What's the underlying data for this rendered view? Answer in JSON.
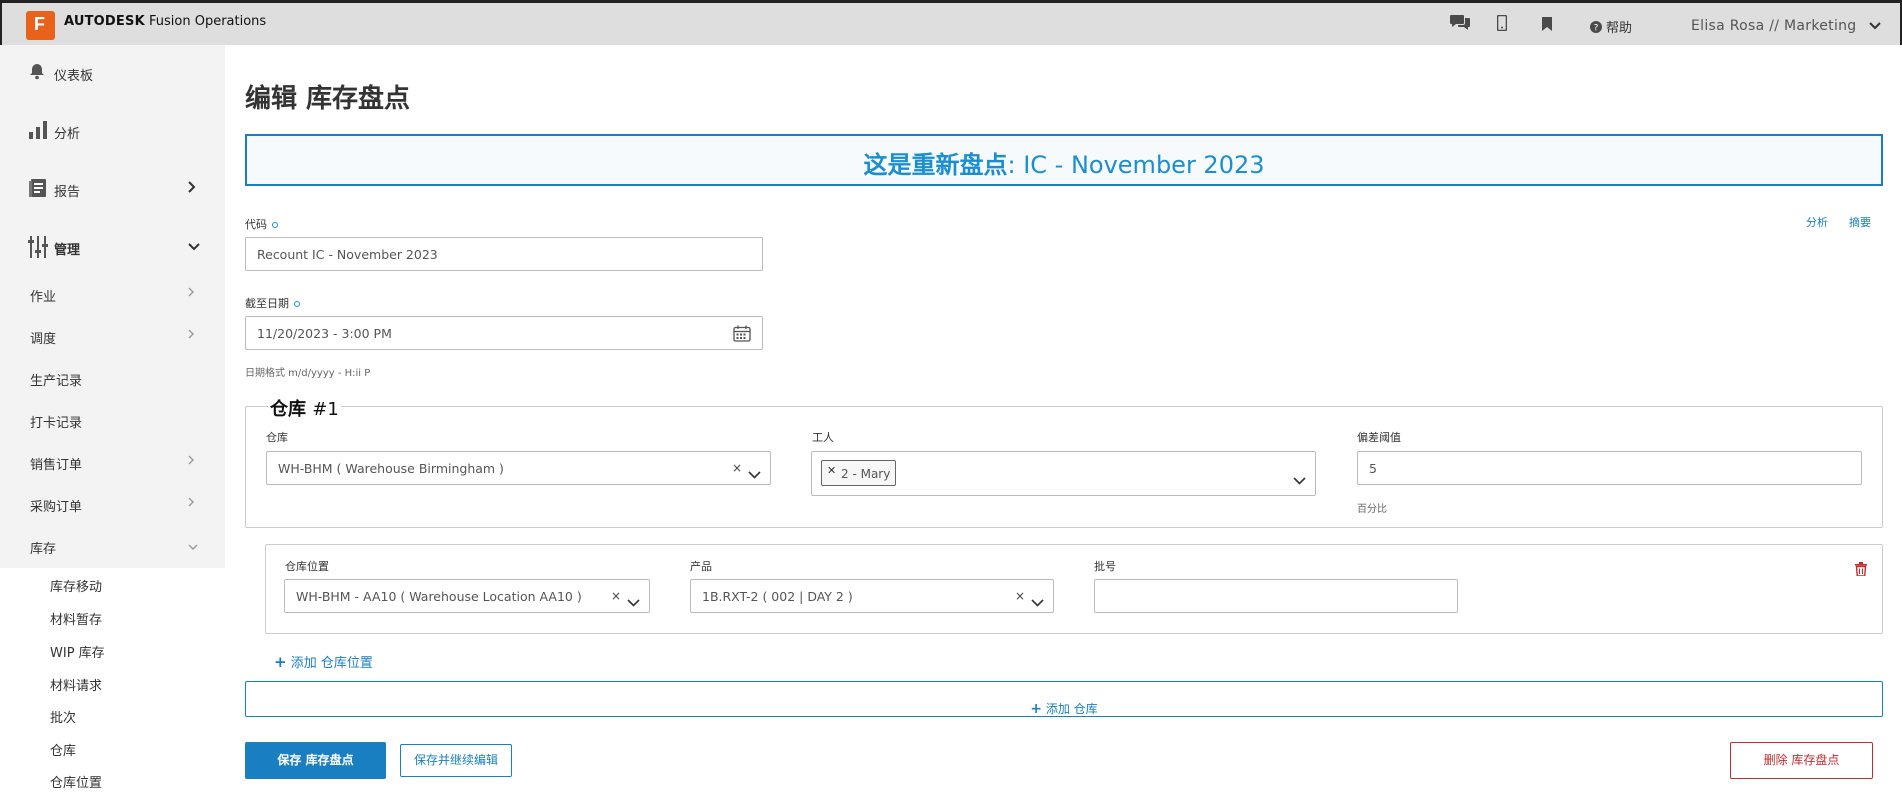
{
  "topbar": {
    "logo_letter": "F",
    "brand_bold": "AUTODESK",
    "brand_rest": " Fusion Operations",
    "icons": [
      "chat-icon",
      "mobile-icon",
      "bookmark-icon",
      "help-icon"
    ],
    "help_label": "帮助",
    "user_label": "Elisa Rosa // Marketing"
  },
  "sidebar": {
    "main": [
      {
        "label": "仪表板",
        "icon": "bell-icon"
      },
      {
        "label": "分析",
        "icon": "bar-chart-icon"
      },
      {
        "label": "报告",
        "icon": "report-icon"
      },
      {
        "label": "管理",
        "icon": "sliders-icon"
      }
    ],
    "sub": [
      {
        "label": "作业",
        "has_arrow": true
      },
      {
        "label": "调度",
        "has_arrow": true
      },
      {
        "label": "生产记录",
        "has_arrow": false
      },
      {
        "label": "打卡记录",
        "has_arrow": false
      },
      {
        "label": "销售订单",
        "has_arrow": true
      },
      {
        "label": "采购订单",
        "has_arrow": true
      },
      {
        "label": "库存",
        "has_arrow": true
      }
    ],
    "inventory_items": [
      "库存移动",
      "材料暂存",
      "WIP 库存",
      "材料请求",
      "批次",
      "仓库",
      "仓库位置"
    ]
  },
  "page": {
    "title": "编辑 库存盘点",
    "banner_bold": "这是重新盘点",
    "banner_rest": ": IC - November 2023",
    "links": {
      "analysis": "分析",
      "summary": "摘要"
    }
  },
  "form": {
    "code": {
      "label": "代码",
      "value": "Recount IC - November 2023"
    },
    "deadline": {
      "label": "截至日期",
      "value": "11/20/2023 - 3:00 PM",
      "hint": "日期格式 m/d/yyyy - H:ii P"
    },
    "warehouse_group": {
      "legend": "仓库",
      "legend_num": "#1",
      "warehouse": {
        "label": "仓库",
        "value": "WH-BHM ( Warehouse Birmingham )"
      },
      "worker": {
        "label": "工人",
        "tag": "2 - Mary"
      },
      "threshold": {
        "label": "偏差阈值",
        "value": "5",
        "hint": "百分比"
      }
    },
    "location_row": {
      "location": {
        "label": "仓库位置",
        "value": "WH-BHM - AA10 ( Warehouse Location AA10 )"
      },
      "product": {
        "label": "产品",
        "value": "1B.RXT-2 ( 002 | DAY 2 )"
      },
      "batch": {
        "label": "批号",
        "value": ""
      }
    },
    "add_location_label": "添加 仓库位置",
    "add_warehouse_label": "添加 仓库"
  },
  "buttons": {
    "save": "保存 库存盘点",
    "save_continue": "保存并继续编辑",
    "delete": "删除 库存盘点"
  },
  "colors": {
    "accent": "#1a7fc1",
    "brand_orange": "#e8621b",
    "danger": "#c42b2b"
  }
}
